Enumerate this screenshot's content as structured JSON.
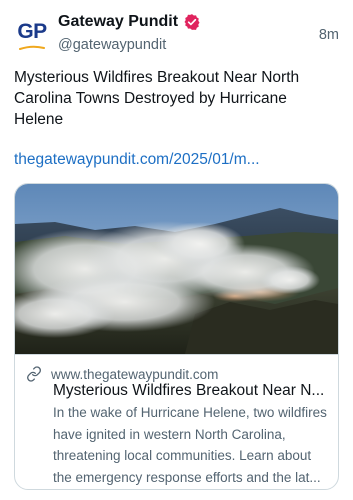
{
  "author": {
    "avatar_text": "GP",
    "display_name": "Gateway Pundit",
    "handle": "@gatewaypundit",
    "verified": true
  },
  "timestamp": "8m",
  "post": {
    "text": "Mysterious Wildfires Breakout Near North Carolina Towns Destroyed by Hurricane Helene",
    "link": "thegatewaypundit.com/2025/01/m..."
  },
  "card": {
    "domain": "www.thegatewaypundit.com",
    "title": "Mysterious Wildfires Breakout Near N...",
    "description": "In the wake of Hurricane Helene, two wildfires have ignited in western North Carolina, threatening local communities. Learn about the emergency response efforts and the lat..."
  },
  "icons": {
    "verified": "verified-badge-icon",
    "link": "link-icon"
  },
  "colors": {
    "link": "#1d6fc4",
    "verified_badge": "#e0245e",
    "secondary_text": "#536471",
    "brand_blue": "#1b3a8a",
    "brand_swoosh": "#f0a81e"
  }
}
